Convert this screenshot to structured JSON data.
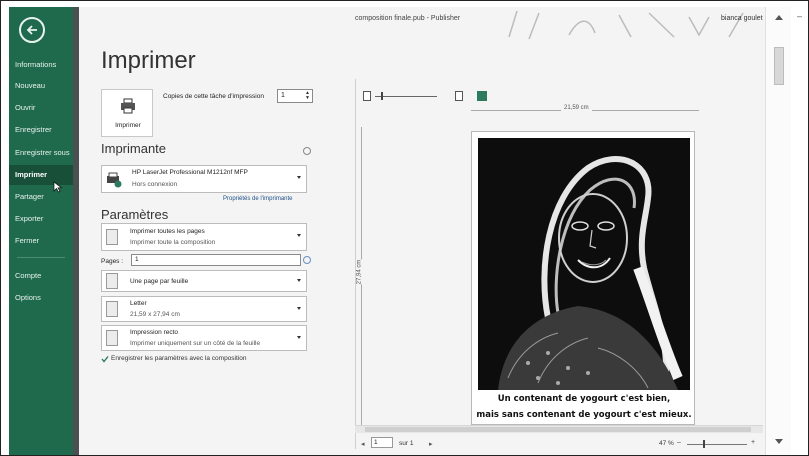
{
  "window": {
    "title": "composition finale.pub - Publisher",
    "user": "bianca goulet",
    "help": "?",
    "minimize": "–"
  },
  "nav": {
    "items": [
      {
        "label": "Informations"
      },
      {
        "label": "Nouveau"
      },
      {
        "label": "Ouvrir"
      },
      {
        "label": "Enregistrer"
      },
      {
        "label": "Enregistrer sous"
      },
      {
        "label": "Imprimer",
        "active": true
      },
      {
        "label": "Partager"
      },
      {
        "label": "Exporter"
      },
      {
        "label": "Fermer"
      },
      {
        "label": "Compte"
      },
      {
        "label": "Options"
      }
    ]
  },
  "print": {
    "title": "Imprimer",
    "button_label": "Imprimer",
    "copies_label": "Copies de cette tâche d'impression",
    "copies_value": "1"
  },
  "printer": {
    "heading": "Imprimante",
    "name": "HP LaserJet Professional M1212nf MFP",
    "status": "Hors connexion",
    "properties_link": "Propriétés de l'imprimante"
  },
  "settings": {
    "heading": "Paramètres",
    "range_title": "Imprimer toutes les pages",
    "range_sub": "Imprimer toute la composition",
    "pages_label": "Pages :",
    "pages_value": "1",
    "layout_title": "Une page par feuille",
    "paper_title": "Letter",
    "paper_sub": "21,59 x 27,94 cm",
    "sides_title": "Impression recto",
    "sides_sub": "Imprimer uniquement sur un côté de la feuille",
    "save_with_doc": "Enregistrer les paramètres avec la composition",
    "save_with_doc_checked": true
  },
  "preview": {
    "width_label": "21,59 cm",
    "height_label": "27,94 cm",
    "caption_line1": "Un contenant de yogourt c'est bien,",
    "caption_line2": "mais sans contenant de yogourt c'est mieux.",
    "page_current": "1",
    "page_of": "sur 1",
    "zoom": "47 %"
  },
  "colors": {
    "nav_bg": "#1f6a4c",
    "accent": "#2c7b5d",
    "link": "#1f4f8a"
  }
}
